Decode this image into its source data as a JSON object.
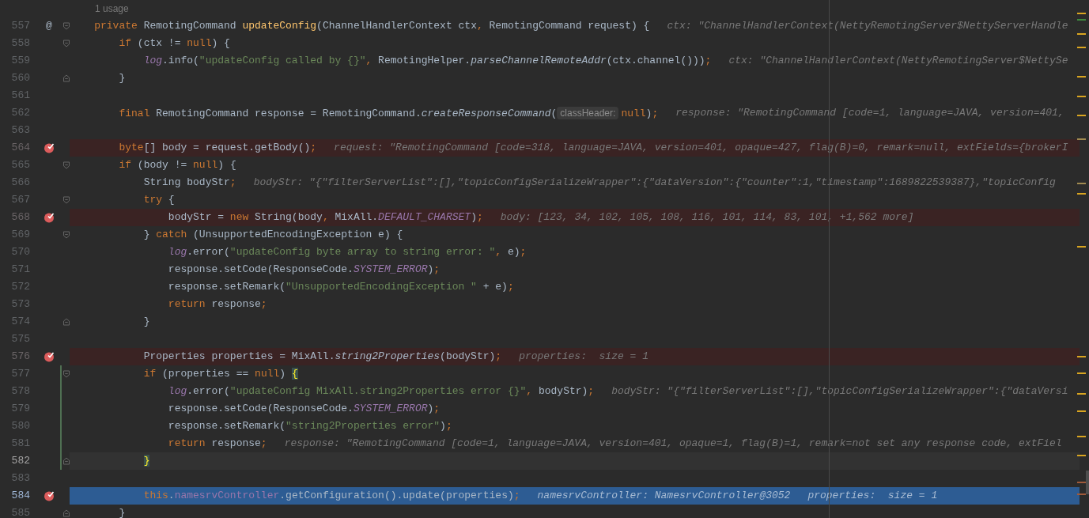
{
  "code_vision": {
    "text": "1 usage"
  },
  "lines": [
    {
      "number": "557",
      "gutter_mark": "@",
      "fold": {
        "kind": "start"
      },
      "breakpoint": false,
      "current": false,
      "caret": false,
      "modified": false,
      "tokens": [
        {
          "kind": "kw",
          "text": "    private "
        },
        {
          "kind": "plain",
          "text": "RemotingCommand "
        },
        {
          "kind": "decl",
          "text": "updateConfig"
        },
        {
          "kind": "plain",
          "text": "(ChannelHandlerContext ctx"
        },
        {
          "kind": "kw",
          "text": ", "
        },
        {
          "kind": "plain",
          "text": "RemotingCommand request) {"
        }
      ],
      "hints": [
        "ctx: \"ChannelHandlerContext(NettyRemotingServer$NettyServerHandle"
      ]
    },
    {
      "number": "558",
      "fold": {
        "kind": "start"
      },
      "breakpoint": false,
      "current": false,
      "caret": false,
      "modified": false,
      "tokens": [
        {
          "kind": "kw",
          "text": "        if"
        },
        {
          "kind": "plain",
          "text": " (ctx != "
        },
        {
          "kind": "kw",
          "text": "null"
        },
        {
          "kind": "plain",
          "text": ") {"
        }
      ]
    },
    {
      "number": "559",
      "breakpoint": false,
      "current": false,
      "caret": false,
      "modified": false,
      "tokens": [
        {
          "kind": "field_static",
          "text": "            log"
        },
        {
          "kind": "plain",
          "text": ".info("
        },
        {
          "kind": "str",
          "text": "\"updateConfig called by {}\""
        },
        {
          "kind": "kw",
          "text": ", "
        },
        {
          "kind": "plain",
          "text": "RemotingHelper."
        },
        {
          "kind": "static",
          "text": "parseChannelRemoteAddr"
        },
        {
          "kind": "plain",
          "text": "(ctx.channel()))"
        },
        {
          "kind": "kw",
          "text": ";"
        }
      ],
      "hints": [
        "ctx: \"ChannelHandlerContext(NettyRemotingServer$NettySe"
      ]
    },
    {
      "number": "560",
      "fold": {
        "kind": "end"
      },
      "breakpoint": false,
      "current": false,
      "caret": false,
      "modified": false,
      "tokens": [
        {
          "kind": "plain",
          "text": "        }"
        }
      ]
    },
    {
      "number": "561",
      "breakpoint": false,
      "current": false,
      "caret": false,
      "modified": false
    },
    {
      "number": "562",
      "breakpoint": false,
      "current": false,
      "caret": false,
      "modified": false,
      "tokens": [
        {
          "kind": "kw",
          "text": "        final "
        },
        {
          "kind": "plain",
          "text": "RemotingCommand response = RemotingCommand."
        },
        {
          "kind": "static",
          "text": "createResponseCommand"
        },
        {
          "kind": "plain",
          "text": "("
        },
        {
          "kind": "param_hint",
          "text": "classHeader:"
        },
        {
          "kind": "kw",
          "text": "null"
        },
        {
          "kind": "plain",
          "text": ")"
        },
        {
          "kind": "kw",
          "text": ";"
        }
      ],
      "hints": [
        "response: \"RemotingCommand [code=1, language=JAVA, version=401,"
      ]
    },
    {
      "number": "563",
      "breakpoint": false,
      "current": false,
      "caret": false,
      "modified": false
    },
    {
      "number": "564",
      "breakpoint": true,
      "current": false,
      "caret": false,
      "modified": false,
      "tokens": [
        {
          "kind": "kw",
          "text": "        byte"
        },
        {
          "kind": "plain",
          "text": "[] body = request.getBody()"
        },
        {
          "kind": "kw",
          "text": ";"
        }
      ],
      "hints": [
        "request: \"RemotingCommand [code=318, language=JAVA, version=401, opaque=427, flag(B)=0, remark=null, extFields={brokerI"
      ]
    },
    {
      "number": "565",
      "fold": {
        "kind": "start"
      },
      "breakpoint": false,
      "current": false,
      "caret": false,
      "modified": false,
      "tokens": [
        {
          "kind": "kw",
          "text": "        if"
        },
        {
          "kind": "plain",
          "text": " (body != "
        },
        {
          "kind": "kw",
          "text": "null"
        },
        {
          "kind": "plain",
          "text": ") {"
        }
      ]
    },
    {
      "number": "566",
      "breakpoint": false,
      "current": false,
      "caret": false,
      "modified": false,
      "tokens": [
        {
          "kind": "plain",
          "text": "            String bodyStr"
        },
        {
          "kind": "kw",
          "text": ";"
        }
      ],
      "hints": [
        "bodyStr: \"{\"filterServerList\":[],\"topicConfigSerializeWrapper\":{\"dataVersion\":{\"counter\":1,\"timestamp\":1689822539387},\"topicConfig"
      ]
    },
    {
      "number": "567",
      "fold": {
        "kind": "start"
      },
      "breakpoint": false,
      "current": false,
      "caret": false,
      "modified": false,
      "tokens": [
        {
          "kind": "kw",
          "text": "            try"
        },
        {
          "kind": "plain",
          "text": " {"
        }
      ]
    },
    {
      "number": "568",
      "breakpoint": true,
      "current": false,
      "caret": false,
      "modified": false,
      "tokens": [
        {
          "kind": "plain",
          "text": "                bodyStr = "
        },
        {
          "kind": "kw",
          "text": "new "
        },
        {
          "kind": "plain",
          "text": "String(body"
        },
        {
          "kind": "kw",
          "text": ", "
        },
        {
          "kind": "plain",
          "text": "MixAll."
        },
        {
          "kind": "const",
          "text": "DEFAULT_CHARSET"
        },
        {
          "kind": "plain",
          "text": ")"
        },
        {
          "kind": "kw",
          "text": ";"
        }
      ],
      "hints": [
        "body: [123, 34, 102, 105, 108, 116, 101, 114, 83, 101, +1,562 more]"
      ]
    },
    {
      "number": "569",
      "fold": {
        "kind": "start"
      },
      "breakpoint": false,
      "current": false,
      "caret": false,
      "modified": false,
      "tokens": [
        {
          "kind": "plain",
          "text": "            } "
        },
        {
          "kind": "kw",
          "text": "catch"
        },
        {
          "kind": "plain",
          "text": " (UnsupportedEncodingException e) {"
        }
      ]
    },
    {
      "number": "570",
      "breakpoint": false,
      "current": false,
      "caret": false,
      "modified": false,
      "tokens": [
        {
          "kind": "field_static",
          "text": "                log"
        },
        {
          "kind": "plain",
          "text": ".error("
        },
        {
          "kind": "str",
          "text": "\"updateConfig byte array to string error: \""
        },
        {
          "kind": "kw",
          "text": ", "
        },
        {
          "kind": "plain",
          "text": "e)"
        },
        {
          "kind": "kw",
          "text": ";"
        }
      ]
    },
    {
      "number": "571",
      "breakpoint": false,
      "current": false,
      "caret": false,
      "modified": false,
      "tokens": [
        {
          "kind": "plain",
          "text": "                response.setCode(ResponseCode."
        },
        {
          "kind": "const",
          "text": "SYSTEM_ERROR"
        },
        {
          "kind": "plain",
          "text": ")"
        },
        {
          "kind": "kw",
          "text": ";"
        }
      ]
    },
    {
      "number": "572",
      "breakpoint": false,
      "current": false,
      "caret": false,
      "modified": false,
      "tokens": [
        {
          "kind": "plain",
          "text": "                response.setRemark("
        },
        {
          "kind": "str",
          "text": "\"UnsupportedEncodingException \""
        },
        {
          "kind": "plain",
          "text": " + e)"
        },
        {
          "kind": "kw",
          "text": ";"
        }
      ]
    },
    {
      "number": "573",
      "breakpoint": false,
      "current": false,
      "caret": false,
      "modified": false,
      "tokens": [
        {
          "kind": "kw",
          "text": "                return "
        },
        {
          "kind": "plain",
          "text": "response"
        },
        {
          "kind": "kw",
          "text": ";"
        }
      ]
    },
    {
      "number": "574",
      "fold": {
        "kind": "end"
      },
      "breakpoint": false,
      "current": false,
      "caret": false,
      "modified": false,
      "tokens": [
        {
          "kind": "plain",
          "text": "            }"
        }
      ]
    },
    {
      "number": "575",
      "breakpoint": false,
      "current": false,
      "caret": false,
      "modified": false
    },
    {
      "number": "576",
      "breakpoint": true,
      "current": false,
      "caret": false,
      "modified": false,
      "tokens": [
        {
          "kind": "plain",
          "text": "            Properties properties = MixAll."
        },
        {
          "kind": "static",
          "text": "string2Properties"
        },
        {
          "kind": "plain",
          "text": "(bodyStr)"
        },
        {
          "kind": "kw",
          "text": ";"
        }
      ],
      "hints": [
        "properties:  size = 1"
      ]
    },
    {
      "number": "577",
      "fold": {
        "kind": "start"
      },
      "breakpoint": false,
      "current": false,
      "caret": false,
      "modified": true,
      "tokens": [
        {
          "kind": "kw",
          "text": "            if"
        },
        {
          "kind": "plain",
          "text": " (properties == "
        },
        {
          "kind": "kw",
          "text": "null"
        },
        {
          "kind": "plain",
          "text": ") "
        },
        {
          "kind": "brace",
          "text": "{"
        }
      ]
    },
    {
      "number": "578",
      "breakpoint": false,
      "current": false,
      "caret": false,
      "modified": true,
      "tokens": [
        {
          "kind": "field_static",
          "text": "                log"
        },
        {
          "kind": "plain",
          "text": ".error("
        },
        {
          "kind": "str",
          "text": "\"updateConfig MixAll.string2Properties error {}\""
        },
        {
          "kind": "kw",
          "text": ", "
        },
        {
          "kind": "plain",
          "text": "bodyStr)"
        },
        {
          "kind": "kw",
          "text": ";"
        }
      ],
      "hints": [
        "bodyStr: \"{\"filterServerList\":[],\"topicConfigSerializeWrapper\":{\"dataVersi"
      ]
    },
    {
      "number": "579",
      "breakpoint": false,
      "current": false,
      "caret": false,
      "modified": true,
      "tokens": [
        {
          "kind": "plain",
          "text": "                response.setCode(ResponseCode."
        },
        {
          "kind": "const",
          "text": "SYSTEM_ERROR"
        },
        {
          "kind": "plain",
          "text": ")"
        },
        {
          "kind": "kw",
          "text": ";"
        }
      ]
    },
    {
      "number": "580",
      "breakpoint": false,
      "current": false,
      "caret": false,
      "modified": true,
      "tokens": [
        {
          "kind": "plain",
          "text": "                response.setRemark("
        },
        {
          "kind": "str",
          "text": "\"string2Properties error\""
        },
        {
          "kind": "plain",
          "text": ")"
        },
        {
          "kind": "kw",
          "text": ";"
        }
      ]
    },
    {
      "number": "581",
      "breakpoint": false,
      "current": false,
      "caret": false,
      "modified": true,
      "tokens": [
        {
          "kind": "kw",
          "text": "                return "
        },
        {
          "kind": "plain",
          "text": "response"
        },
        {
          "kind": "kw",
          "text": ";"
        }
      ],
      "hints": [
        "response: \"RemotingCommand [code=1, language=JAVA, version=401, opaque=1, flag(B)=1, remark=not set any response code, extFiel"
      ]
    },
    {
      "number": "582",
      "fold": {
        "kind": "end"
      },
      "breakpoint": false,
      "current": false,
      "caret": true,
      "modified": true,
      "tokens": [
        {
          "kind": "brace",
          "text": "            }"
        }
      ]
    },
    {
      "number": "583",
      "breakpoint": false,
      "current": false,
      "caret": false,
      "modified": false
    },
    {
      "number": "584",
      "breakpoint": true,
      "current": true,
      "caret": false,
      "modified": false,
      "tokens": [
        {
          "kind": "kw",
          "text": "            this"
        },
        {
          "kind": "plain",
          "text": "."
        },
        {
          "kind": "field",
          "text": "namesrvController"
        },
        {
          "kind": "plain",
          "text": ".getConfiguration().update(properties)"
        },
        {
          "kind": "kw",
          "text": ";"
        }
      ],
      "hints": [
        "namesrvController: NamesrvController@3052",
        "properties:  size = 1"
      ]
    },
    {
      "number": "585",
      "fold": {
        "kind": "end"
      },
      "breakpoint": false,
      "current": false,
      "caret": false,
      "modified": false,
      "tokens": [
        {
          "kind": "plain",
          "text": "        }"
        }
      ]
    }
  ]
}
